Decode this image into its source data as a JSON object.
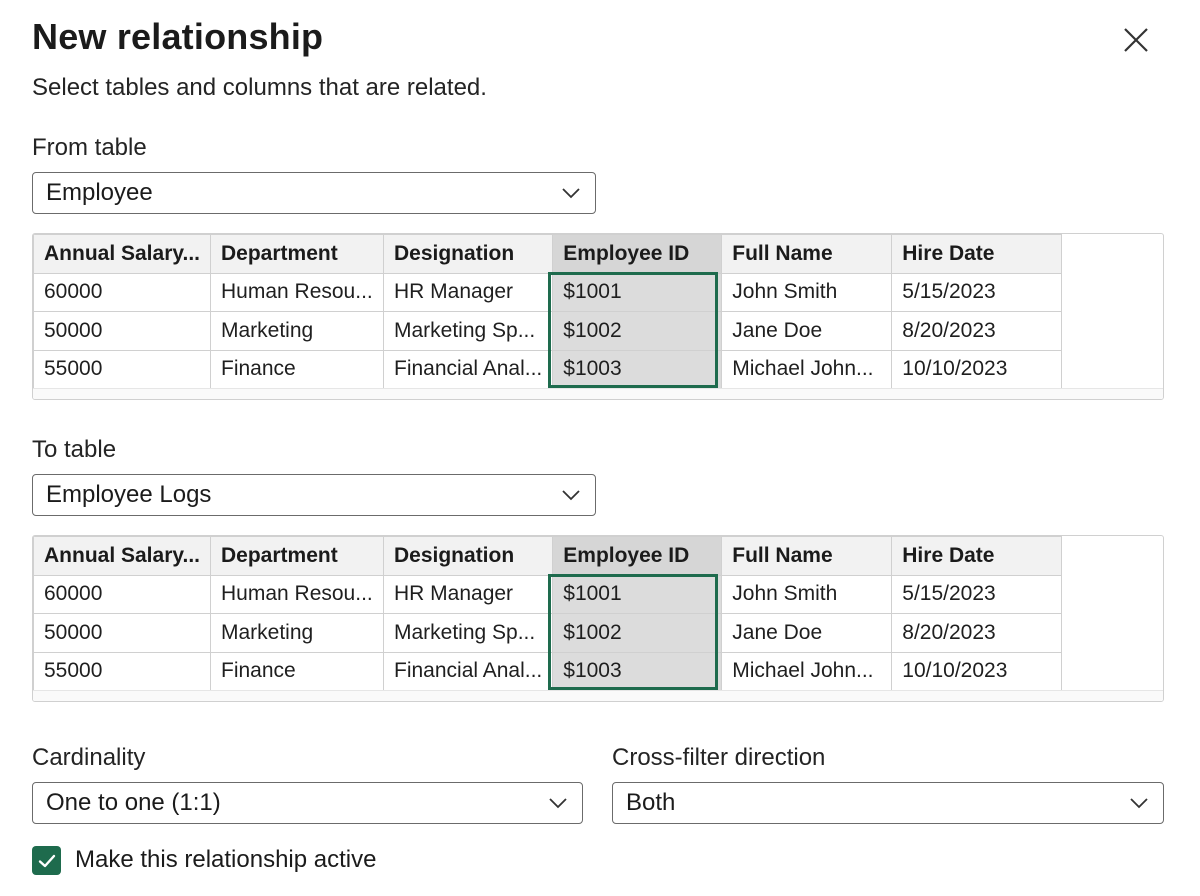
{
  "dialog": {
    "title": "New relationship",
    "subtitle": "Select tables and columns that are related.",
    "close_icon": "close-icon"
  },
  "from_table": {
    "label": "From table",
    "selected": "Employee",
    "columns": [
      "Annual Salary...",
      "Department",
      "Designation",
      "Employee ID",
      "Full Name",
      "Hire Date"
    ],
    "selected_column": "Employee ID",
    "rows": [
      [
        "60000",
        "Human Resou...",
        "HR Manager",
        "$1001",
        "John Smith",
        "5/15/2023"
      ],
      [
        "50000",
        "Marketing",
        "Marketing Sp...",
        "$1002",
        "Jane Doe",
        "8/20/2023"
      ],
      [
        "55000",
        "Finance",
        "Financial Anal...",
        "$1003",
        "Michael John...",
        "10/10/2023"
      ]
    ]
  },
  "to_table": {
    "label": "To table",
    "selected": "Employee Logs",
    "columns": [
      "Annual Salary...",
      "Department",
      "Designation",
      "Employee ID",
      "Full Name",
      "Hire Date"
    ],
    "selected_column": "Employee ID",
    "rows": [
      [
        "60000",
        "Human Resou...",
        "HR Manager",
        "$1001",
        "John Smith",
        "5/15/2023"
      ],
      [
        "50000",
        "Marketing",
        "Marketing Sp...",
        "$1002",
        "Jane Doe",
        "8/20/2023"
      ],
      [
        "55000",
        "Finance",
        "Financial Anal...",
        "$1003",
        "Michael John...",
        "10/10/2023"
      ]
    ]
  },
  "cardinality": {
    "label": "Cardinality",
    "selected": "One to one (1:1)"
  },
  "cross_filter": {
    "label": "Cross-filter direction",
    "selected": "Both"
  },
  "active_checkbox": {
    "label": "Make this relationship active",
    "checked": true
  },
  "colors": {
    "accent": "#1e6b4d",
    "header_bg": "#f2f2f2",
    "selected_col_bg": "#dcdcdc",
    "border": "#d0d0d0"
  }
}
